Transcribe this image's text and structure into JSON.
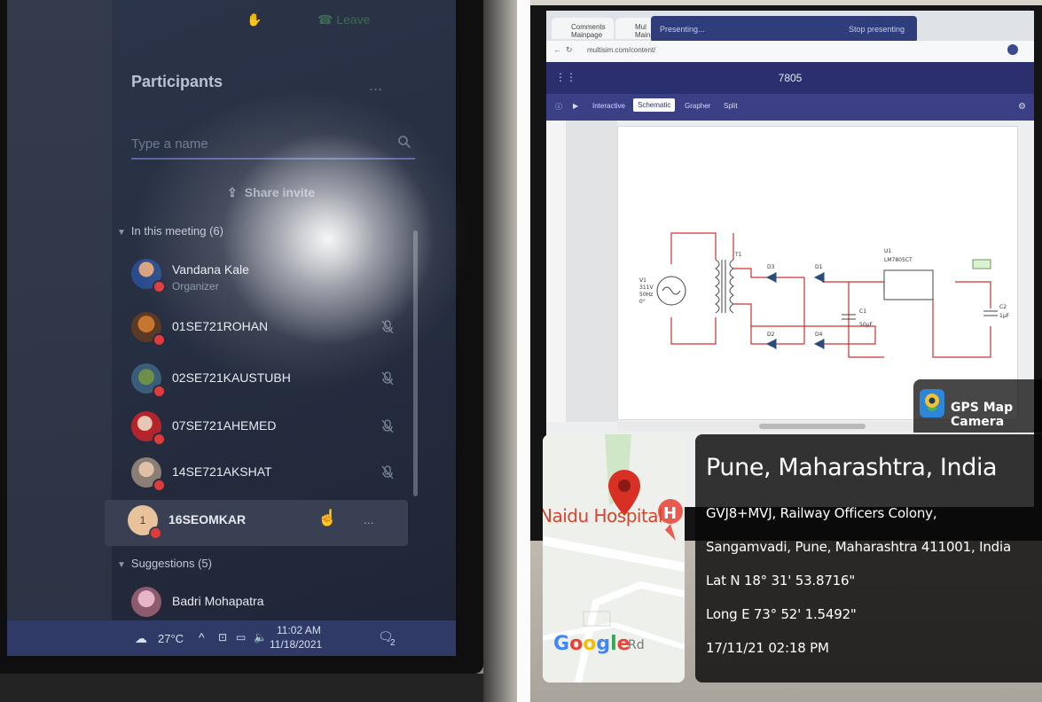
{
  "teams": {
    "top_bar_hint": "Leave",
    "panel_title": "Participants",
    "more_options": "...",
    "search_placeholder": "Type a name",
    "share_invite": "Share invite",
    "in_meeting_header": "In this meeting (6)",
    "participants": [
      {
        "name": "Vandana Kale",
        "role": "Organizer"
      },
      {
        "name": "01SE721ROHAN"
      },
      {
        "name": "02SE721KAUSTUBH"
      },
      {
        "name": "07SE721AHEMED"
      },
      {
        "name": "14SE721AKSHAT"
      },
      {
        "name": "16SEOMKAR",
        "avatar_text": "1"
      }
    ],
    "suggestions_header": "Suggestions (5)",
    "suggestions": [
      {
        "name": "Badri Mohapatra"
      }
    ],
    "row_more": "...",
    "taskbar": {
      "weather": "27°C",
      "time": "11:02 AM",
      "date": "11/18/2021",
      "notif_count": "2"
    }
  },
  "multisim": {
    "browser_tab_1": "Comments Mainpage",
    "browser_tab_2": "Mul Mainpage",
    "share_banner": "Presenting...",
    "share_banner_stop": "Stop presenting",
    "url": "multisim.com/content/",
    "app_title": "7805",
    "toolbar": {
      "interactive": "Interactive",
      "schematic": "Schematic",
      "grapher": "Grapher",
      "split": "Split"
    },
    "schematic_labels": {
      "v1": "V1",
      "v1_val": "311V",
      "v1_freq": "50Hz",
      "v1_phase": "0°",
      "t1": "T1",
      "d1": "D1",
      "d2": "D2",
      "d3": "D3",
      "d4": "D4",
      "c1": "C1",
      "c1_val": "50µF",
      "u1": "U1",
      "u1_part": "LM7805CT",
      "c2": "C2",
      "c2_val": "1µF"
    }
  },
  "gps": {
    "app_name": "GPS Map Camera",
    "map_label": "Naidu Hospital",
    "google": "Google",
    "road": "Rd",
    "city": "Pune, Maharashtra, India",
    "address_1": "GVJ8+MVJ, Railway Officers Colony,",
    "address_2": "Sangamvadi, Pune, Maharashtra 411001, India",
    "lat": "Lat N 18° 31' 53.8716\"",
    "long": "Long E 73° 52' 1.5492\"",
    "datetime": "17/11/21 02:18 PM"
  }
}
